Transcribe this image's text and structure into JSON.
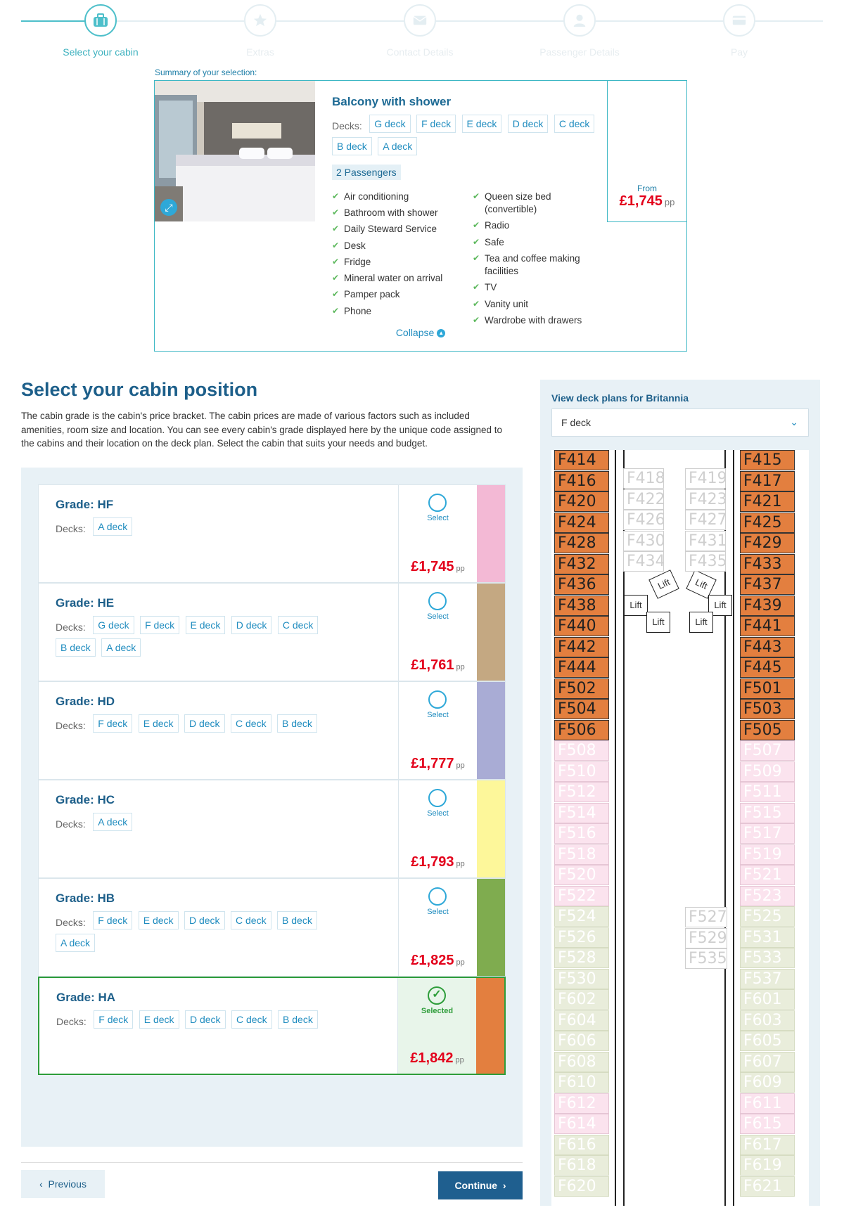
{
  "stepper": {
    "steps": [
      {
        "label": "Select your cabin",
        "icon": "suitcase-icon"
      },
      {
        "label": "Extras",
        "icon": "star-icon"
      },
      {
        "label": "Contact Details",
        "icon": "envelope-icon"
      },
      {
        "label": "Passenger Details",
        "icon": "person-icon"
      },
      {
        "label": "Pay",
        "icon": "credit-card-icon"
      }
    ]
  },
  "summary": {
    "caption": "Summary of your selection:",
    "title": "Balcony with shower",
    "decks_label": "Decks:",
    "decks": [
      "G deck",
      "F deck",
      "E deck",
      "D deck",
      "C deck",
      "B deck",
      "A deck"
    ],
    "passengers": "2 Passengers",
    "features_left": [
      "Air conditioning",
      "Bathroom with shower",
      "Daily Steward Service",
      "Desk",
      "Fridge",
      "Mineral water on arrival",
      "Pamper pack",
      "Phone"
    ],
    "features_right": [
      "Queen size bed (convertible)",
      "Radio",
      "Safe",
      "Tea and coffee making facilities",
      "TV",
      "Vanity unit",
      "Wardrobe with drawers"
    ],
    "from_label": "From",
    "price": "£1,745",
    "pp": "pp",
    "collapse": "Collapse"
  },
  "cabin_position": {
    "title": "Select your cabin position",
    "description": "The cabin grade is the cabin's price bracket. The cabin prices are made of various factors such as included amenities, room size and location. You can see every cabin's grade displayed here by the unique code assigned to the cabins and their location on the deck plan. Select the cabin that suits your needs and budget.",
    "grades": [
      {
        "name": "Grade: HF",
        "decks": [
          "A deck"
        ],
        "price": "£1,745",
        "pp": "pp",
        "select": "Select",
        "color": "#f3b9d5"
      },
      {
        "name": "Grade: HE",
        "decks": [
          "G deck",
          "F deck",
          "E deck",
          "D deck",
          "C deck",
          "B deck",
          "A deck"
        ],
        "price": "£1,761",
        "pp": "pp",
        "select": "Select",
        "color": "#c4a882"
      },
      {
        "name": "Grade: HD",
        "decks": [
          "F deck",
          "E deck",
          "D deck",
          "C deck",
          "B deck"
        ],
        "price": "£1,777",
        "pp": "pp",
        "select": "Select",
        "color": "#a9acd5"
      },
      {
        "name": "Grade: HC",
        "decks": [
          "A deck"
        ],
        "price": "£1,793",
        "pp": "pp",
        "select": "Select",
        "color": "#fdf79a"
      },
      {
        "name": "Grade: HB",
        "decks": [
          "F deck",
          "E deck",
          "D deck",
          "C deck",
          "B deck",
          "A deck"
        ],
        "price": "£1,825",
        "pp": "pp",
        "select": "Select",
        "color": "#7fac4f"
      },
      {
        "name": "Grade: HA",
        "decks": [
          "F deck",
          "E deck",
          "D deck",
          "C deck",
          "B deck"
        ],
        "price": "£1,842",
        "pp": "pp",
        "select": "Selected",
        "color": "#e37f3f"
      }
    ],
    "decks_label": "Decks:"
  },
  "nav": {
    "previous": "Previous",
    "continue": "Continue"
  },
  "deck_plan": {
    "title": "View deck plans for Britannia",
    "selected_deck": "F deck",
    "lift_label": "Lift",
    "left_column": [
      {
        "code": "F414",
        "type": "o"
      },
      {
        "code": "F416",
        "type": "o"
      },
      {
        "code": "F420",
        "type": "o"
      },
      {
        "code": "F424",
        "type": "o"
      },
      {
        "code": "F428",
        "type": "o"
      },
      {
        "code": "F432",
        "type": "o"
      },
      {
        "code": "F436",
        "type": "o"
      },
      {
        "code": "F438",
        "type": "o"
      },
      {
        "code": "F440",
        "type": "o"
      },
      {
        "code": "F442",
        "type": "o"
      },
      {
        "code": "F444",
        "type": "o"
      },
      {
        "code": "F502",
        "type": "o"
      },
      {
        "code": "F504",
        "type": "o"
      },
      {
        "code": "F506",
        "type": "o"
      },
      {
        "code": "F508",
        "type": "p"
      },
      {
        "code": "F510",
        "type": "p"
      },
      {
        "code": "F512",
        "type": "p"
      },
      {
        "code": "F514",
        "type": "p"
      },
      {
        "code": "F516",
        "type": "p"
      },
      {
        "code": "F518",
        "type": "p"
      },
      {
        "code": "F520",
        "type": "p"
      },
      {
        "code": "F522",
        "type": "p"
      },
      {
        "code": "F524",
        "type": "g"
      },
      {
        "code": "F526",
        "type": "g"
      },
      {
        "code": "F528",
        "type": "g"
      },
      {
        "code": "F530",
        "type": "g"
      },
      {
        "code": "F602",
        "type": "g"
      },
      {
        "code": "F604",
        "type": "g"
      },
      {
        "code": "F606",
        "type": "g"
      },
      {
        "code": "F608",
        "type": "g"
      },
      {
        "code": "F610",
        "type": "g"
      },
      {
        "code": "F612",
        "type": "p"
      },
      {
        "code": "F614",
        "type": "p"
      },
      {
        "code": "F616",
        "type": "g"
      },
      {
        "code": "F618",
        "type": "g"
      },
      {
        "code": "F620",
        "type": "g"
      }
    ],
    "right_column": [
      {
        "code": "F415",
        "type": "o"
      },
      {
        "code": "F417",
        "type": "o"
      },
      {
        "code": "F421",
        "type": "o"
      },
      {
        "code": "F425",
        "type": "o"
      },
      {
        "code": "F429",
        "type": "o"
      },
      {
        "code": "F433",
        "type": "o"
      },
      {
        "code": "F437",
        "type": "o"
      },
      {
        "code": "F439",
        "type": "o"
      },
      {
        "code": "F441",
        "type": "o"
      },
      {
        "code": "F443",
        "type": "o"
      },
      {
        "code": "F445",
        "type": "o"
      },
      {
        "code": "F501",
        "type": "o"
      },
      {
        "code": "F503",
        "type": "o"
      },
      {
        "code": "F505",
        "type": "o"
      },
      {
        "code": "F507",
        "type": "p"
      },
      {
        "code": "F509",
        "type": "p"
      },
      {
        "code": "F511",
        "type": "p"
      },
      {
        "code": "F515",
        "type": "p"
      },
      {
        "code": "F517",
        "type": "p"
      },
      {
        "code": "F519",
        "type": "p"
      },
      {
        "code": "F521",
        "type": "p"
      },
      {
        "code": "F523",
        "type": "p"
      },
      {
        "code": "F525",
        "type": "g"
      },
      {
        "code": "F531",
        "type": "g"
      },
      {
        "code": "F533",
        "type": "g"
      },
      {
        "code": "F537",
        "type": "g"
      },
      {
        "code": "F601",
        "type": "g"
      },
      {
        "code": "F603",
        "type": "g"
      },
      {
        "code": "F605",
        "type": "g"
      },
      {
        "code": "F607",
        "type": "g"
      },
      {
        "code": "F609",
        "type": "g"
      },
      {
        "code": "F611",
        "type": "p"
      },
      {
        "code": "F615",
        "type": "p"
      },
      {
        "code": "F617",
        "type": "g"
      },
      {
        "code": "F619",
        "type": "g"
      },
      {
        "code": "F621",
        "type": "g"
      }
    ],
    "inner_left": [
      "F418",
      "F422",
      "F426",
      "F430",
      "F434"
    ],
    "inner_right": [
      "F419",
      "F423",
      "F427",
      "F431",
      "F435"
    ],
    "center_block": [
      "F527",
      "F529",
      "F535"
    ]
  }
}
